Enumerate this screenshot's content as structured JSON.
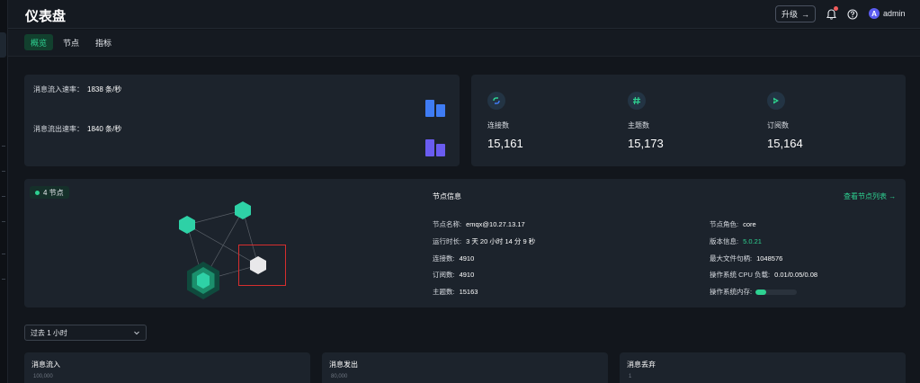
{
  "header": {
    "title": "仪表盘",
    "upgrade_label": "升级",
    "upgrade_arrow": "→",
    "avatar_letter": "A",
    "user": "admin"
  },
  "tabs": [
    {
      "label": "概览",
      "active": true
    },
    {
      "label": "节点",
      "active": false
    },
    {
      "label": "指标",
      "active": false
    }
  ],
  "rates": {
    "in_label": "消息流入速率：",
    "in_value": "1838 条/秒",
    "out_label": "消息流出速率：",
    "out_value": "1840 条/秒"
  },
  "stats": [
    {
      "icon": "connection-icon",
      "label": "连接数",
      "value": "15,161"
    },
    {
      "icon": "hash-icon",
      "label": "主题数",
      "value": "15,173"
    },
    {
      "icon": "subscription-icon",
      "label": "订阅数",
      "value": "15,164"
    }
  ],
  "nodes": {
    "badge": "4 节点",
    "info_title": "节点信息",
    "view_link": "查看节点列表 →",
    "left": [
      {
        "label": "节点名称:",
        "value": "emqx@10.27.13.17"
      },
      {
        "label": "运行时长:",
        "value": "3 天 20 小时 14 分 9 秒"
      },
      {
        "label": "连接数:",
        "value": "4910"
      },
      {
        "label": "订阅数:",
        "value": "4910"
      },
      {
        "label": "主题数:",
        "value": "15163"
      }
    ],
    "right": [
      {
        "label": "节点角色:",
        "value": "core"
      },
      {
        "label": "版本信息:",
        "value": "5.0.21"
      },
      {
        "label": "最大文件句柄:",
        "value": "1048576"
      },
      {
        "label": "操作系统 CPU 负载:",
        "value": "0.01/0.05/0.08"
      },
      {
        "label": "操作系统内存:",
        "value": ""
      }
    ],
    "memory_fraction": 0.25
  },
  "time_range": {
    "selected": "过去 1 小时"
  },
  "charts": [
    {
      "title": "消息流入",
      "axis_top": "100,000"
    },
    {
      "title": "消息发出",
      "axis_top": "80,000"
    },
    {
      "title": "消息丢弃",
      "axis_top": "1"
    }
  ],
  "colors": {
    "accent": "#2ed191",
    "bar_blue": "#3f7cf4",
    "bar_purple": "#6a5cf0",
    "highlight_box": "#d62e2e"
  }
}
